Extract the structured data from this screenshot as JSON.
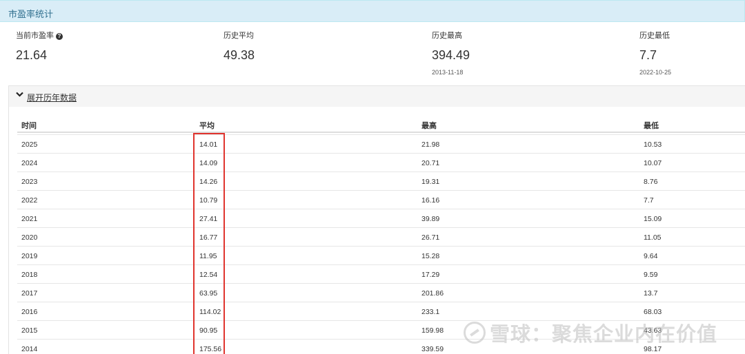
{
  "panel": {
    "title": "市盈率统计"
  },
  "stats": [
    {
      "label": "当前市盈率",
      "value": "21.64",
      "date": "",
      "has_help": true
    },
    {
      "label": "历史平均",
      "value": "49.38",
      "date": ""
    },
    {
      "label": "历史最高",
      "value": "394.49",
      "date": "2013-11-18"
    },
    {
      "label": "历史最低",
      "value": "7.7",
      "date": "2022-10-25"
    }
  ],
  "help_icon": "question-circle-icon",
  "toggle": {
    "icon": "chevron-down-icon",
    "label": "展开历年数据"
  },
  "table": {
    "headers": [
      "时间",
      "平均",
      "最高",
      "最低"
    ],
    "rows": [
      [
        "2025",
        "14.01",
        "21.98",
        "10.53"
      ],
      [
        "2024",
        "14.09",
        "20.71",
        "10.07"
      ],
      [
        "2023",
        "14.26",
        "19.31",
        "8.76"
      ],
      [
        "2022",
        "10.79",
        "16.16",
        "7.7"
      ],
      [
        "2021",
        "27.41",
        "39.89",
        "15.09"
      ],
      [
        "2020",
        "16.77",
        "26.71",
        "11.05"
      ],
      [
        "2019",
        "11.95",
        "15.28",
        "9.64"
      ],
      [
        "2018",
        "12.54",
        "17.29",
        "9.59"
      ],
      [
        "2017",
        "63.95",
        "201.86",
        "13.7"
      ],
      [
        "2016",
        "114.02",
        "233.1",
        "68.03"
      ],
      [
        "2015",
        "90.95",
        "159.98",
        "43.63"
      ],
      [
        "2014",
        "175.56",
        "339.59",
        "98.17"
      ]
    ]
  },
  "watermark": {
    "text": "雪球：聚焦企业内在价值"
  },
  "colors": {
    "header_bg": "#d9edf7",
    "header_text": "#31708f",
    "highlight": "#e0332d"
  }
}
